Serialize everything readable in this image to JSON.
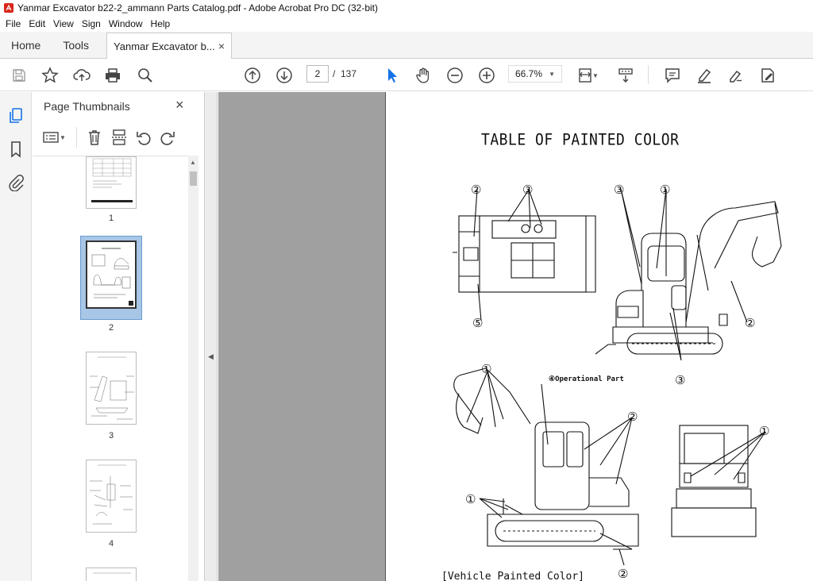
{
  "window": {
    "title": "Yanmar Excavator b22-2_ammann  Parts Catalog.pdf - Adobe Acrobat Pro DC (32-bit)"
  },
  "menu": [
    "File",
    "Edit",
    "View",
    "Sign",
    "Window",
    "Help"
  ],
  "tabs": {
    "home": "Home",
    "tools": "Tools",
    "document": "Yanmar Excavator b...",
    "close": "×"
  },
  "toolbar": {
    "page_current": "2",
    "page_sep": "/",
    "page_total": "137",
    "zoom": "66.7%"
  },
  "thumbnails_panel": {
    "title": "Page Thumbnails",
    "close": "×",
    "pages": [
      {
        "num": "1",
        "selected": false
      },
      {
        "num": "2",
        "selected": true
      },
      {
        "num": "3",
        "selected": false
      },
      {
        "num": "4",
        "selected": false
      }
    ]
  },
  "document": {
    "title": "TABLE OF PAINTED COLOR",
    "operational_label": "④Operational Part",
    "footer_label": "[Vehicle Painted Color]",
    "callouts": [
      "①",
      "②",
      "③",
      "④",
      "⑤"
    ]
  },
  "colors": {
    "accent": "#1473e6",
    "selection": "#a8c6e6",
    "doc_bg": "#a0a0a0"
  }
}
